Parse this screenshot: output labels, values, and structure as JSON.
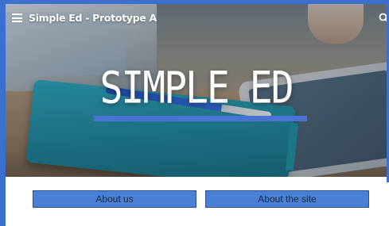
{
  "header": {
    "site_title": "Simple Ed - Prototype A",
    "menu_icon": "hamburger-menu-icon",
    "search_icon": "search-icon"
  },
  "hero": {
    "title": "SIMPLE ED",
    "accent_color": "#4a74d1"
  },
  "buttons": {
    "about_us": "About us",
    "about_site": "About the site",
    "color": "#4a7fd6"
  },
  "colors": {
    "frame": "#3b6fd0"
  }
}
